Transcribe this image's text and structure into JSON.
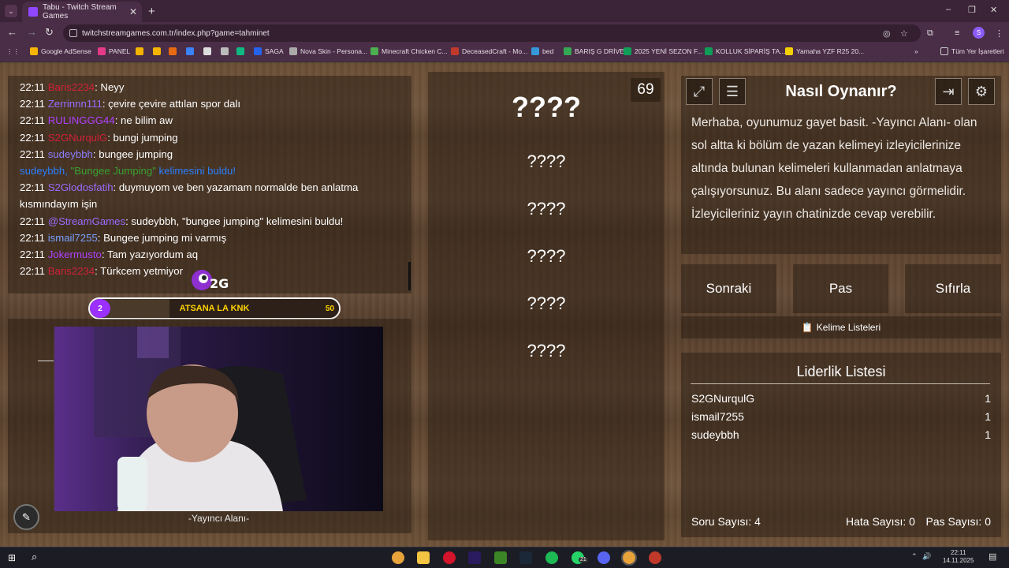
{
  "browser": {
    "tab_title": "Tabu - Twitch Stream Games",
    "url": "twitchstreamgames.com.tr/index.php?game=tahminet",
    "bookmarks": [
      "Google AdSense",
      "PANEL",
      "SAGA",
      "Nova Skin - Persona...",
      "Minecraft Chicken C...",
      "DeceasedCraft - Mo...",
      "bed",
      "BARIŞ G DRİVE",
      "2025 YENİ SEZON F...",
      "KOLLUK SİPARİŞ TA...",
      "Yamaha YZF R25 20..."
    ],
    "all_bookmarks": "Tüm Yer İşaretleri",
    "profile_initial": "S"
  },
  "chat": {
    "messages": [
      {
        "time": "22:11",
        "user": "Baris2234",
        "text": ": Neyy",
        "color": "#d0223a"
      },
      {
        "time": "22:11",
        "user": "Zerrinnn111",
        "text": ": çevire çevire attılan spor dalı",
        "color": "#9b6bff"
      },
      {
        "time": "22:11",
        "user": "RULINGGG44",
        "text": ": ne bilim aw",
        "color": "#b040ff"
      },
      {
        "time": "22:11",
        "user": "S2GNurqulG",
        "text": ": bungi jumping",
        "color": "#d0223a"
      },
      {
        "time": "22:11",
        "user": "sudeybbh",
        "text": ": bungee jumping",
        "color": "#8a7dff"
      },
      {
        "time": "",
        "user": "sudeybbh,",
        "text": "",
        "color": "#2a7fff",
        "system": true,
        "quote": "\"Bungee Jumping\"",
        "suffix": " kelimesini buldu!"
      },
      {
        "time": "22:11",
        "user": "S2Glodosfatih",
        "text": ": duymuyom ve ben yazamam normalde ben anlatma kısmındayım işin",
        "color": "#9b6bff"
      },
      {
        "time": "22:11",
        "user": "@StreamGames",
        "text": ": sudeybbh, \"bungee jumping\" kelimesini buldu!",
        "color": "#9b6bff"
      },
      {
        "time": "22:11",
        "user": "ismail7255",
        "text": ": Bungee jumping mi varmış",
        "color": "#7aa0ff"
      },
      {
        "time": "22:11",
        "user": "Jokermusto",
        "text": ": Tam yazıyordum aq",
        "color": "#b040ff"
      },
      {
        "time": "22:11",
        "user": "Baris2234",
        "text": ": Türkcem yetmiyor",
        "color": "#d0223a"
      }
    ]
  },
  "progress": {
    "current": "2",
    "label": "ATSANA LA KNK",
    "max": "50",
    "fraction": 0.04
  },
  "streamer": {
    "label": "-Yayıncı Alanı-"
  },
  "words": {
    "main": "????",
    "items": [
      "????",
      "????",
      "????",
      "????",
      "????"
    ]
  },
  "timer": "69",
  "howto": {
    "title": "Nasıl Oynanır?",
    "text": "Merhaba, oyunumuz gayet basit. -Yayıncı Alanı- olan sol altta ki bölüm de yazan kelimeyi izleyicilerinize altında bulunan kelimeleri kullanmadan anlatmaya çalışıyorsunuz. Bu alanı sadece yayıncı görmelidir. İzleyicileriniz yayın chatinizde cevap verebilir."
  },
  "buttons": {
    "next": "Sonraki",
    "pass": "Pas",
    "reset": "Sıfırla",
    "word_lists": "Kelime Listeleri"
  },
  "leaderboard": {
    "title": "Liderlik Listesi",
    "rows": [
      {
        "name": "S2GNurqulG",
        "score": "1"
      },
      {
        "name": "ismail7255",
        "score": "1"
      },
      {
        "name": "sudeybbh",
        "score": "1"
      }
    ]
  },
  "stats": {
    "questions": "Soru Sayısı: 4",
    "errors": "Hata Sayısı: 0",
    "passes": "Pas Sayısı: 0"
  },
  "taskbar": {
    "time": "22:11",
    "date": "14.11.2025",
    "badge": "21"
  }
}
